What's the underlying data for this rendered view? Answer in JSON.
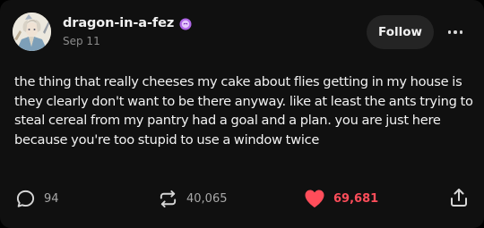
{
  "post": {
    "username": "dragon-in-a-fez",
    "date": "Sep 11",
    "follow_label": "Follow",
    "body": "the thing that really cheeses my cake about flies getting in my house is they clearly don't want to be there anyway. like at least the ants trying to steal cereal from my pantry had a goal and a plan. you are just here because you're too stupid to use a window twice"
  },
  "actions": {
    "replies": "94",
    "reblogs": "40,065",
    "likes": "69,681"
  },
  "icons": {
    "badge": "purple-badge-icon",
    "more": "more-options-icon",
    "reply": "speech-bubble-icon",
    "reblog": "reblog-arrows-icon",
    "like": "heart-icon",
    "share": "share-icon"
  },
  "colors": {
    "background": "#101010",
    "like_accent": "#ff4d5a",
    "badge": "#b067e8"
  }
}
